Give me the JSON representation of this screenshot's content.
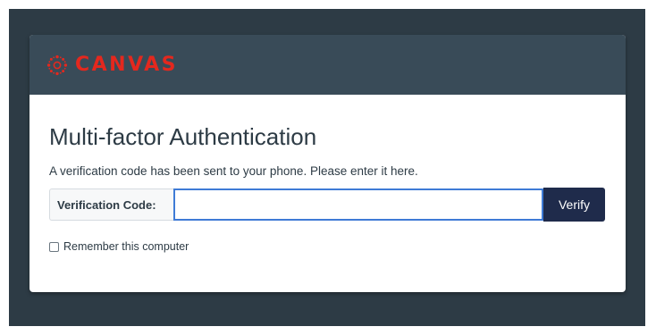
{
  "header": {
    "brand_name": "CANVAS",
    "logo_icon": "canvas-logo-icon",
    "brand_color": "#e4281e",
    "header_color": "#394b58"
  },
  "page": {
    "background_color": "#2d3b45",
    "title": "Multi-factor Authentication",
    "message": "A verification code has been sent to your phone. Please enter it here."
  },
  "verification": {
    "label": "Verification Code:",
    "value": "",
    "placeholder": "",
    "verify_label": "Verify",
    "button_color": "#1f2b4b",
    "focus_color": "#3f7bd6"
  },
  "remember": {
    "label": "Remember this computer",
    "checked": false
  }
}
